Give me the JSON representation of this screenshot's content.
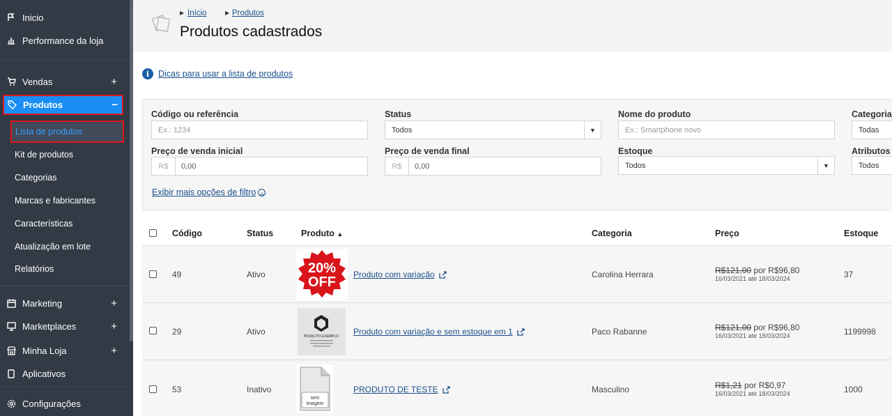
{
  "sidebar": {
    "items": [
      {
        "label": "Inicio",
        "icon": "flag-icon"
      },
      {
        "label": "Performance da loja",
        "icon": "bar-chart-icon"
      },
      {
        "label": "Vendas",
        "icon": "cart-icon",
        "expand": "+"
      },
      {
        "label": "Produtos",
        "icon": "tag-icon",
        "expand": "−"
      },
      {
        "label": "Marketing",
        "icon": "calendar-icon",
        "expand": "+"
      },
      {
        "label": "Marketplaces",
        "icon": "monitor-icon",
        "expand": "+"
      },
      {
        "label": "Minha Loja",
        "icon": "store-icon",
        "expand": "+"
      },
      {
        "label": "Aplicativos",
        "icon": "phone-icon"
      },
      {
        "label": "Configurações",
        "icon": "gear-icon"
      }
    ],
    "subitems": [
      "Lista de produtos",
      "Kit de produtos",
      "Categorias",
      "Marcas e fabricantes",
      "Características",
      "Atualização em lote",
      "Relatórios"
    ]
  },
  "breadcrumb": [
    "Início",
    "Produtos"
  ],
  "page_title": "Produtos cadastrados",
  "tips_link": "Dicas para usar a lista de produtos",
  "filters": {
    "code_label": "Código ou referência",
    "code_placeholder": "Ex.: 1234",
    "status_label": "Status",
    "status_value": "Todos",
    "name_label": "Nome do produto",
    "name_placeholder": "Ex.: Smartphone novo",
    "category_label": "Categoria",
    "category_value": "Todas",
    "price_start_label": "Preço de venda inicial",
    "price_end_label": "Preço de venda final",
    "currency": "R$",
    "price_start_value": "0,00",
    "price_end_value": "0,00",
    "stock_label": "Estoque",
    "stock_value": "Todos",
    "attributes_label": "Atributos",
    "attributes_value": "Todos",
    "more_filters": "Exibir mais opções de filtro"
  },
  "table": {
    "headers": {
      "code": "Código",
      "status": "Status",
      "product": "Produto",
      "category": "Categoria",
      "price": "Preço",
      "stock": "Estoque"
    },
    "sort_indicator": "▲",
    "rows": [
      {
        "code": "49",
        "status": "Ativo",
        "product": "Produto com variação",
        "category": "Carolina Herrara",
        "old_price": "R$121,00",
        "price_by": "por R$96,80",
        "dates": "16/03/2021 até 18/03/2024",
        "stock": "37",
        "thumb": "20% OFF"
      },
      {
        "code": "29",
        "status": "Ativo",
        "product": "Produto com variação e sem estoque em 1",
        "category": "Paco Rabanne",
        "old_price": "R$121,00",
        "price_by": "por R$96,80",
        "dates": "16/03/2021 até 18/03/2024",
        "stock": "1199998",
        "thumb": "PRODUTO EXEMPLO"
      },
      {
        "code": "53",
        "status": "Inativo",
        "product": "PRODUTO DE TESTE",
        "category": "Masculino",
        "old_price": "R$1,21",
        "price_by": "por R$0,97",
        "dates": "16/03/2021 até 18/03/2024",
        "stock": "1000",
        "thumb": "sem imagem"
      }
    ]
  },
  "colors": {
    "sidebar": "#323a45",
    "active": "#1a8ef5",
    "highlight": "#e0161b",
    "link": "#1a4f8a"
  }
}
